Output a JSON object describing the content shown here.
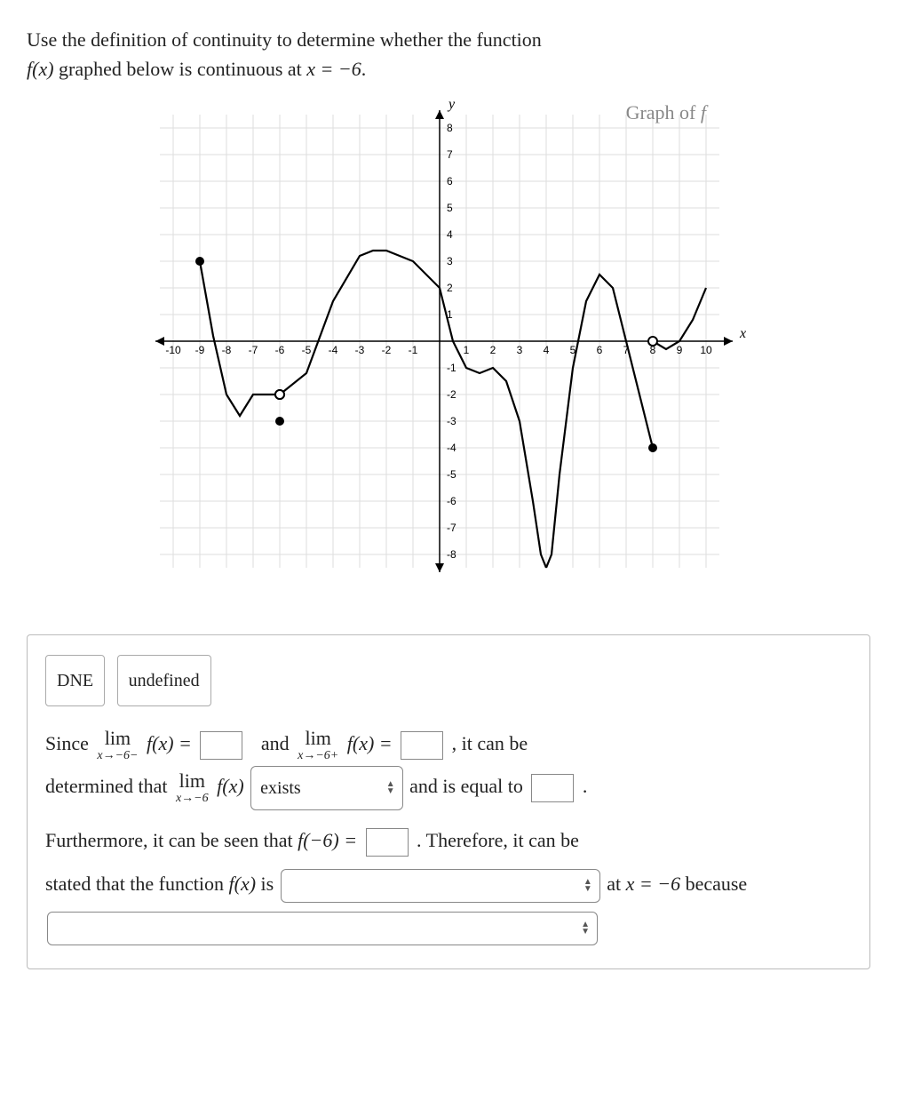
{
  "question": {
    "line1_prefix": "Use the definition of continuity to determine whether the function",
    "fn": "f(x)",
    "line2_mid": " graphed below is continuous at ",
    "eq": "x = −6",
    "period": "."
  },
  "graph": {
    "title_prefix": "Graph of ",
    "title_fn": "f",
    "xlabel": "x",
    "ylabel": "y",
    "x_ticks": [
      -10,
      -9,
      -8,
      -7,
      -6,
      -5,
      -4,
      -3,
      -2,
      -1,
      1,
      2,
      3,
      4,
      5,
      6,
      7,
      8,
      9,
      10
    ],
    "y_ticks": [
      8,
      7,
      6,
      5,
      4,
      3,
      2,
      1,
      -1,
      -2,
      -3,
      -4,
      -5,
      -6,
      -7,
      -8
    ]
  },
  "chart_data": {
    "type": "line",
    "xlabel": "x",
    "ylabel": "y",
    "xlim": [
      -10.5,
      10.5
    ],
    "ylim": [
      -8.5,
      8.5
    ],
    "grid": true,
    "series": [
      {
        "name": "f-left",
        "x": [
          -9,
          -8.5,
          -8,
          -7.5,
          -7,
          -6.5,
          -6
        ],
        "values": [
          3,
          0.2,
          -2,
          -2.8,
          -2,
          -2,
          -2
        ],
        "start_point": {
          "x": -9,
          "y": 3,
          "style": "closed"
        },
        "end_point": {
          "x": -6,
          "y": -2,
          "style": "open"
        }
      },
      {
        "name": "f-mid",
        "x": [
          -6,
          -5,
          -4,
          -3,
          -2.5,
          -2,
          -1,
          0,
          0.5,
          1,
          1.5,
          2,
          2.5,
          3,
          3.5,
          3.8,
          4
        ],
        "values": [
          -2,
          -1.2,
          1.5,
          3.2,
          3.4,
          3.4,
          3,
          2,
          0,
          -1,
          -1.2,
          -1,
          -1.5,
          -3,
          -6,
          -8,
          -8.5
        ],
        "start_point": {
          "x": -6,
          "y": -2,
          "style": "open"
        },
        "note": "arrow down near x≈4 (asymptote)"
      },
      {
        "name": "f-right1",
        "x": [
          4,
          4.2,
          4.5,
          5,
          5.5,
          6,
          6.5,
          7,
          7.5,
          8
        ],
        "values": [
          -8.5,
          -8,
          -5,
          -1,
          1.5,
          2.5,
          2,
          0,
          -2,
          -4
        ],
        "note": "rises from -∞ just right of x=4",
        "end_point": {
          "x": 8,
          "y": -4,
          "style": "closed"
        }
      },
      {
        "name": "f-right2",
        "x": [
          8,
          8.5,
          9,
          9.5,
          10
        ],
        "values": [
          0,
          -0.3,
          0,
          0.8,
          2
        ],
        "start_point": {
          "x": 8,
          "y": 0,
          "style": "open"
        }
      }
    ],
    "points": [
      {
        "x": -6,
        "y": -3,
        "style": "closed",
        "note": "f(-6) defined value"
      }
    ]
  },
  "tokens": {
    "dne": "DNE",
    "undefined": "undefined"
  },
  "answer": {
    "since": "Since ",
    "lim_text": "lim",
    "lim_left_sub": "x→−6−",
    "fx_eq": " f(x) = ",
    "and": "and ",
    "lim_right_sub": "x→−6+",
    "it_can_be": ", it can be",
    "determined": "determined that ",
    "lim_both_sub": "x→−6",
    "select_exists": "exists",
    "and_equal": " and is equal to ",
    "period": ".",
    "furthermore": "Furthermore, it can be seen that ",
    "f_neg6_eq": "f(−6) = ",
    "therefore": ". Therefore, it can be",
    "stated": "stated that the function ",
    "fx": "f(x)",
    "is": " is ",
    "at_x_eq": " at ",
    "x_eq_neg6": "x = −6",
    "because": " because"
  }
}
